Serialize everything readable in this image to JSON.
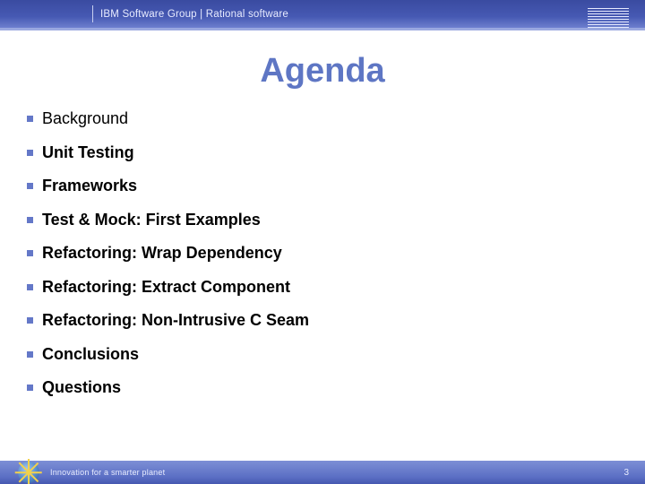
{
  "header": {
    "text": "IBM Software Group | Rational software",
    "logo_name": "IBM"
  },
  "slide": {
    "title": "Agenda",
    "items": [
      {
        "text": "Background",
        "bold": false
      },
      {
        "text": "Unit Testing",
        "bold": true
      },
      {
        "text": "Frameworks",
        "bold": true
      },
      {
        "text": "Test & Mock: First Examples",
        "bold": true
      },
      {
        "text": "Refactoring: Wrap Dependency",
        "bold": true
      },
      {
        "text": "Refactoring: Extract Component",
        "bold": true
      },
      {
        "text": "Refactoring: Non-Intrusive C Seam",
        "bold": true
      },
      {
        "text": "Conclusions",
        "bold": true
      },
      {
        "text": "Questions",
        "bold": true
      }
    ]
  },
  "footer": {
    "tagline": "Innovation for a smarter planet",
    "page_number": "3"
  }
}
